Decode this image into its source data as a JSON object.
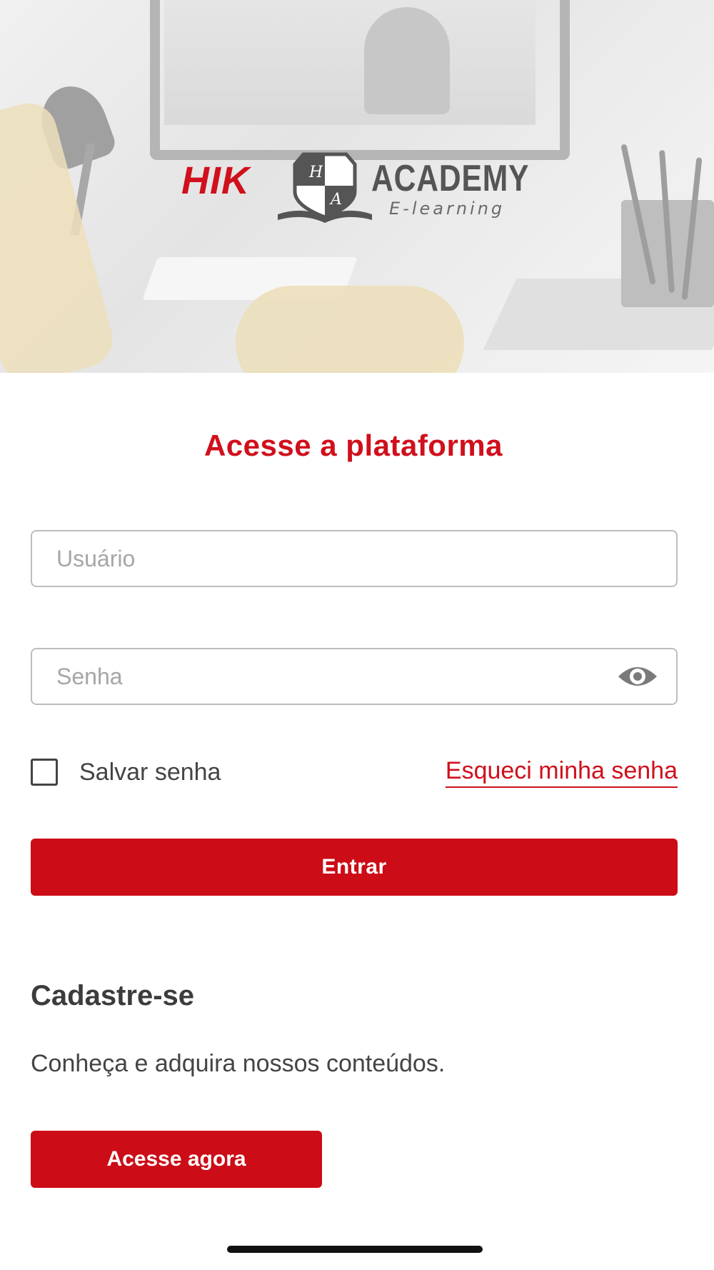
{
  "hero": {
    "logo": {
      "brand": "HIK",
      "name": "ACADEMY",
      "tagline": "E-learning",
      "crest_letters": [
        "H",
        "A"
      ],
      "brand_color": "#d0101c"
    }
  },
  "login": {
    "title": "Acesse a plataforma",
    "username_placeholder": "Usuário",
    "password_placeholder": "Senha",
    "password_toggle_icon": "eye-icon",
    "remember_label": "Salvar senha",
    "remember_checked": false,
    "forgot_link": "Esqueci minha senha",
    "submit_label": "Entrar"
  },
  "signup": {
    "title": "Cadastre-se",
    "description": "Conheça e adquira nossos conteúdos.",
    "button_label": "Acesse agora"
  },
  "colors": {
    "accent": "#cc0c17",
    "title_red": "#d0101c",
    "text_dark": "#3c3c3c",
    "placeholder": "#a6a6a6"
  }
}
